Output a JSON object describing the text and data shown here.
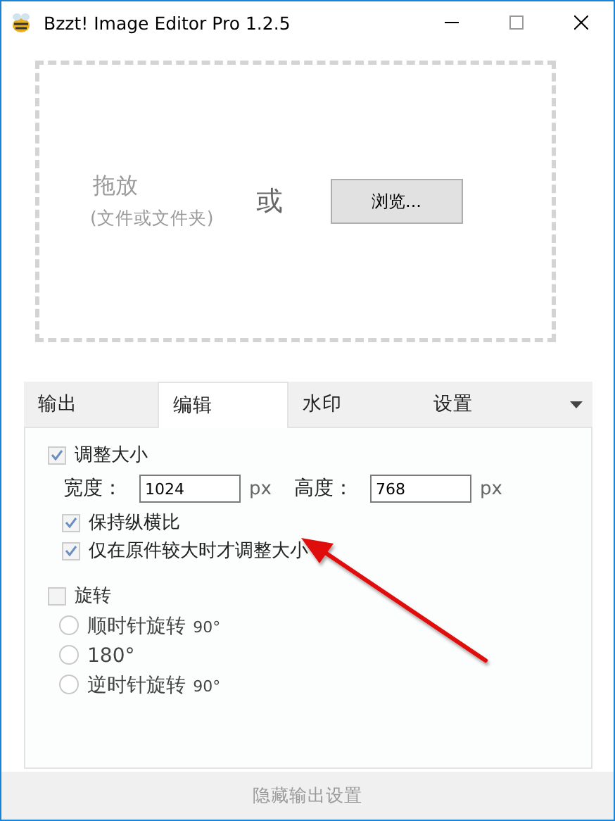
{
  "window": {
    "title": "Bzzt! Image Editor Pro 1.2.5"
  },
  "drop_zone": {
    "hint": "拖放",
    "hint_sub": "(文件或文件夹)",
    "or": "或",
    "browse_button": "浏览..."
  },
  "tabs": [
    {
      "label": "输出",
      "selected": false
    },
    {
      "label": "编辑",
      "selected": true
    },
    {
      "label": "水印",
      "selected": false
    },
    {
      "label": "设置",
      "selected": false
    }
  ],
  "resize": {
    "label": "调整大小",
    "checked": true,
    "width_label": "宽度：",
    "width_value": "1024",
    "width_unit": "px",
    "height_label": "高度：",
    "height_value": "768",
    "height_unit": "px",
    "options": [
      {
        "label": "保持纵横比",
        "checked": true
      },
      {
        "label": "仅在原件较大时才调整大小",
        "checked": true
      }
    ]
  },
  "rotate": {
    "label": "旋转",
    "checked": false,
    "options": [
      {
        "label": "顺时针旋转",
        "suffix": "90°",
        "selected": false
      },
      {
        "label": "180°",
        "selected": false
      },
      {
        "label": "逆时针旋转",
        "suffix": "90°",
        "selected": false
      }
    ]
  },
  "footer": {
    "label": "隐藏输出设置"
  }
}
